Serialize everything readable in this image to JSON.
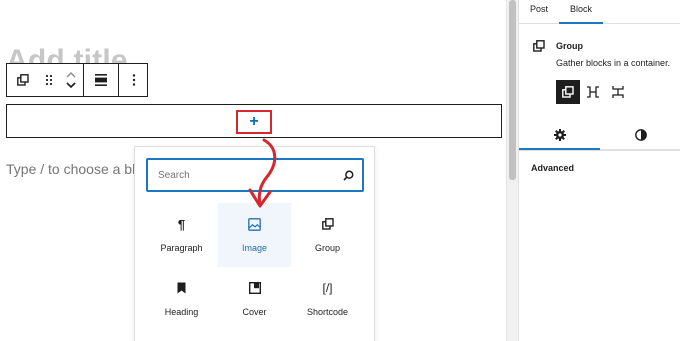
{
  "editor": {
    "title_placeholder": "Add title",
    "paragraph_placeholder": "Type / to choose a block",
    "appender_symbol": "+"
  },
  "block_toolbar": {
    "icons": [
      "group-icon",
      "drag-handle-icon",
      "move-up-icon",
      "move-down-icon",
      "align-icon",
      "more-options-icon"
    ]
  },
  "inserter": {
    "search": {
      "placeholder": "Search",
      "value": ""
    },
    "items": [
      {
        "label": "Paragraph",
        "icon": "paragraph-icon",
        "glyph": "¶",
        "active": false
      },
      {
        "label": "Image",
        "icon": "image-icon",
        "glyph": "",
        "active": true
      },
      {
        "label": "Group",
        "icon": "group-icon",
        "glyph": "",
        "active": false
      },
      {
        "label": "Heading",
        "icon": "bookmark-icon",
        "glyph": "",
        "active": false
      },
      {
        "label": "Cover",
        "icon": "cover-icon",
        "glyph": "",
        "active": false
      },
      {
        "label": "Shortcode",
        "icon": "shortcode-icon",
        "glyph": "[/]",
        "active": false
      }
    ]
  },
  "sidebar": {
    "tabs": [
      {
        "label": "Post",
        "active": false
      },
      {
        "label": "Block",
        "active": true
      }
    ],
    "block_card": {
      "title": "Group",
      "description": "Gather blocks in a container."
    },
    "variations": [
      "group-variation-icon",
      "row-variation-icon",
      "stack-variation-icon"
    ],
    "subtabs": [
      "settings-gear-icon",
      "styles-contrast-icon"
    ],
    "advanced_label": "Advanced"
  },
  "colors": {
    "accent": "#1c78c0",
    "annotation": "#d6262e",
    "highlight_bg": "#f0f6fc"
  }
}
